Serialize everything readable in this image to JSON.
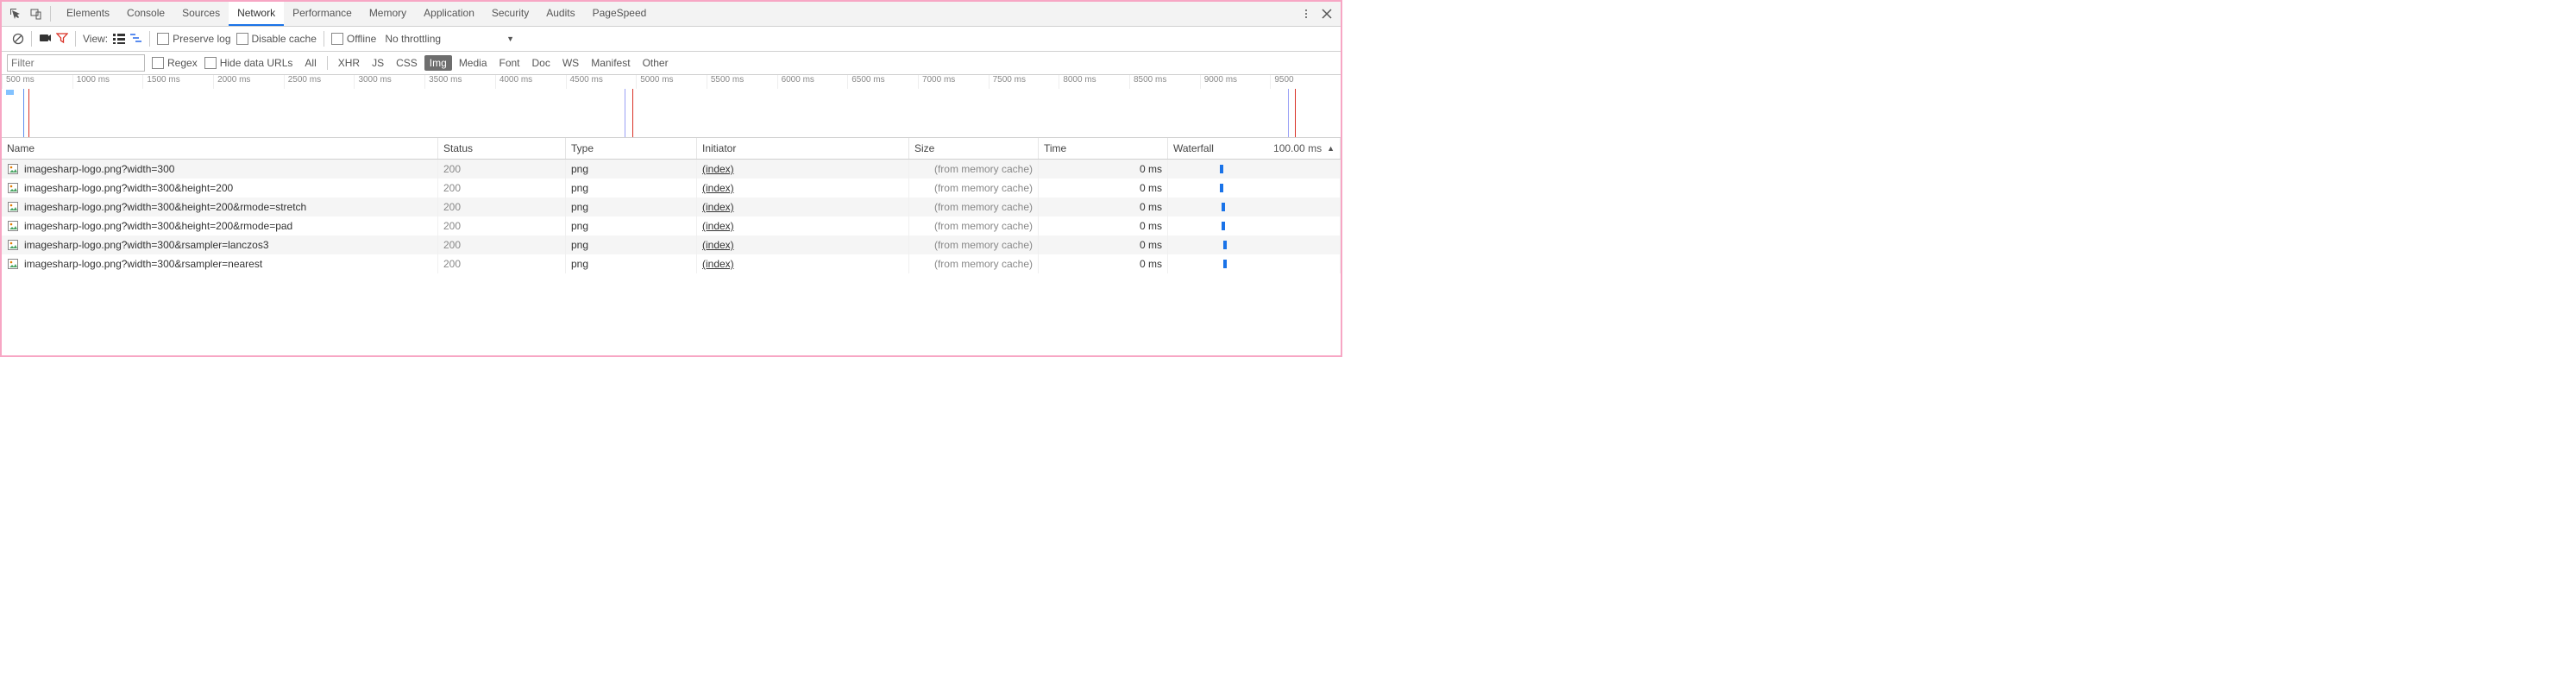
{
  "topTabs": {
    "items": [
      "Elements",
      "Console",
      "Sources",
      "Network",
      "Performance",
      "Memory",
      "Application",
      "Security",
      "Audits",
      "PageSpeed"
    ],
    "activeIndex": 3
  },
  "toolbar": {
    "viewLabel": "View:",
    "preserveLog": "Preserve log",
    "disableCache": "Disable cache",
    "offline": "Offline",
    "throttling": "No throttling"
  },
  "filter": {
    "placeholder": "Filter",
    "regex": "Regex",
    "hideDataUrls": "Hide data URLs",
    "types": [
      "All",
      "XHR",
      "JS",
      "CSS",
      "Img",
      "Media",
      "Font",
      "Doc",
      "WS",
      "Manifest",
      "Other"
    ],
    "activeTypeIndex": 4
  },
  "timeline": {
    "ticks": [
      "500 ms",
      "1000 ms",
      "1500 ms",
      "2000 ms",
      "2500 ms",
      "3000 ms",
      "3500 ms",
      "4000 ms",
      "4500 ms",
      "5000 ms",
      "5500 ms",
      "6000 ms",
      "6500 ms",
      "7000 ms",
      "7500 ms",
      "8000 ms",
      "8500 ms",
      "9000 ms",
      "9500"
    ],
    "markers": [
      {
        "leftPct": 1.6,
        "color": "#5b8def"
      },
      {
        "leftPct": 2.0,
        "color": "#d93025"
      },
      {
        "leftPct": 46.5,
        "color": "#9aa0f6"
      },
      {
        "leftPct": 47.1,
        "color": "#d93025"
      },
      {
        "leftPct": 96.1,
        "color": "#9aa0f6"
      },
      {
        "leftPct": 96.6,
        "color": "#d93025"
      }
    ],
    "smallBars": [
      {
        "leftPct": 0.3,
        "widthPct": 0.6,
        "color": "#83c2ff"
      }
    ]
  },
  "columns": {
    "name": "Name",
    "status": "Status",
    "type": "Type",
    "initiator": "Initiator",
    "size": "Size",
    "time": "Time",
    "waterfall": "Waterfall",
    "waterfallTime": "100.00 ms"
  },
  "rows": [
    {
      "name": "imagesharp-logo.png?width=300",
      "status": "200",
      "type": "png",
      "initiator": "(index)",
      "size": "(from memory cache)",
      "time": "0 ms",
      "wfLeftPct": 30
    },
    {
      "name": "imagesharp-logo.png?width=300&height=200",
      "status": "200",
      "type": "png",
      "initiator": "(index)",
      "size": "(from memory cache)",
      "time": "0 ms",
      "wfLeftPct": 30
    },
    {
      "name": "imagesharp-logo.png?width=300&height=200&rmode=stretch",
      "status": "200",
      "type": "png",
      "initiator": "(index)",
      "size": "(from memory cache)",
      "time": "0 ms",
      "wfLeftPct": 31
    },
    {
      "name": "imagesharp-logo.png?width=300&height=200&rmode=pad",
      "status": "200",
      "type": "png",
      "initiator": "(index)",
      "size": "(from memory cache)",
      "time": "0 ms",
      "wfLeftPct": 31
    },
    {
      "name": "imagesharp-logo.png?width=300&rsampler=lanczos3",
      "status": "200",
      "type": "png",
      "initiator": "(index)",
      "size": "(from memory cache)",
      "time": "0 ms",
      "wfLeftPct": 32
    },
    {
      "name": "imagesharp-logo.png?width=300&rsampler=nearest",
      "status": "200",
      "type": "png",
      "initiator": "(index)",
      "size": "(from memory cache)",
      "time": "0 ms",
      "wfLeftPct": 32
    }
  ]
}
